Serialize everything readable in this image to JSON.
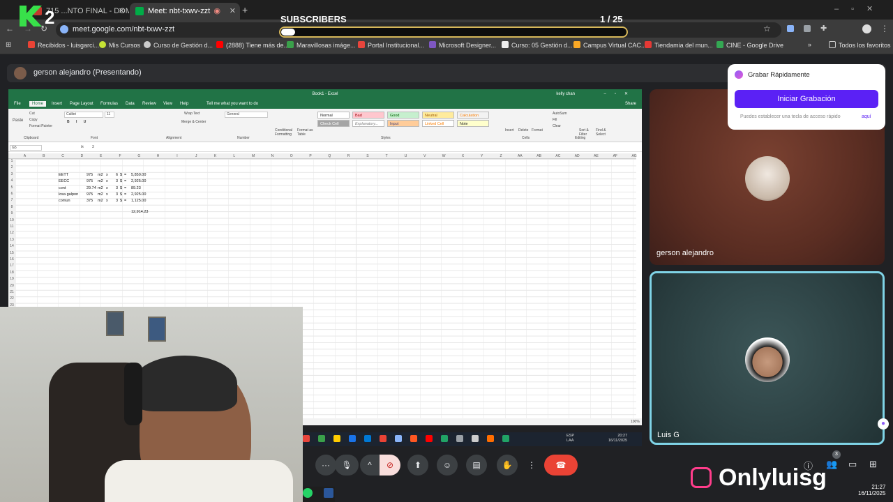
{
  "browser": {
    "tabs": [
      {
        "label": "715 ...NTO FINAL - DOMING"
      },
      {
        "label": "Meet: nbt-txwv-zzt"
      }
    ],
    "url": "meet.google.com/nbt-txwv-zzt",
    "bookmarks": [
      "Recibidos - luisgarci...",
      "Mis Cursos",
      "Curso de Gestión d...",
      "(2888) Tiene más de...",
      "Maravillosas imáge...",
      "Portal Institucional...",
      "Microsoft Designer...",
      "Curso: 05 Gestión d...",
      "Campus Virtual CAC...",
      "Tiendamia del mun...",
      "CINE - Google Drive"
    ],
    "all_bookmarks": "Todos los favoritos"
  },
  "overlay": {
    "subscribers_label": "SUBSCRIBERS",
    "subscribers_count": "1 / 25",
    "subscribers_progress": 0.04,
    "brand_name": "Onlyluisg",
    "logo_text": "K2"
  },
  "meet": {
    "presenter_label": "gerson alejandro (Presentando)",
    "participants": [
      {
        "name": "gerson alejandro"
      },
      {
        "name": "Luis G"
      }
    ],
    "people_count": "3",
    "record_popup": {
      "title": "Grabar Rápidamente",
      "button": "Iniciar Grabación",
      "hint": "Puedes establecer una tecla de acceso rápido",
      "hint_link": "aquí"
    },
    "clock_time": "21:27",
    "clock_date": "16/11/2025"
  },
  "excel": {
    "title": "Book1 - Excel",
    "user": "kelly chan",
    "share": "Share",
    "tabs": [
      "File",
      "Home",
      "Insert",
      "Page Layout",
      "Formulas",
      "Data",
      "Review",
      "View",
      "Help"
    ],
    "tell_me": "Tell me what you want to do",
    "font": "Calibri",
    "font_size": "11",
    "number_format": "General",
    "wrap_text": "Wrap Text",
    "merge_center": "Merge & Center",
    "groups": [
      "Clipboard",
      "Font",
      "Alignment",
      "Number",
      "Styles",
      "Cells",
      "Editing"
    ],
    "styles": [
      "Normal",
      "Bad",
      "Good",
      "Neutral",
      "Calculation",
      "Check Cell",
      "Explanatory...",
      "Input",
      "Linked Cell",
      "Note"
    ],
    "cells_buttons": [
      "Insert",
      "Delete",
      "Format"
    ],
    "editing_buttons": [
      "AutoSum",
      "Fill",
      "Clear",
      "Sort & Filter",
      "Find & Select"
    ],
    "conditional": "Conditional Formatting",
    "format_table": "Format as Table",
    "clipboard": [
      "Cut",
      "Copy",
      "Format Painter"
    ],
    "paste": "Paste",
    "name_box": "G5",
    "formula": "3",
    "columns": [
      "A",
      "B",
      "C",
      "D",
      "E",
      "F",
      "G",
      "H",
      "I",
      "J",
      "K",
      "L",
      "M",
      "N",
      "O",
      "P",
      "Q",
      "R",
      "S",
      "T",
      "U",
      "V",
      "W",
      "X",
      "Y",
      "Z",
      "AA",
      "AB",
      "AC",
      "AD",
      "AE",
      "AF",
      "AG"
    ],
    "rows": [
      {
        "label": "EETT",
        "qty": "975",
        "unit": "m2",
        "x": "x",
        "price": "6",
        "cur": "$",
        "eq": "=",
        "total": "5,850.00"
      },
      {
        "label": "EECC",
        "qty": "975",
        "unit": "m2",
        "x": "x",
        "price": "3",
        "cur": "$",
        "eq": "=",
        "total": "2,925.00"
      },
      {
        "label": "cont",
        "qty": "29.74",
        "unit": "m2",
        "x": "x",
        "price": "3",
        "cur": "$",
        "eq": "=",
        "total": "89.23"
      },
      {
        "label": "losa galpon",
        "qty": "975",
        "unit": "m2",
        "x": "x",
        "price": "3",
        "cur": "$",
        "eq": "=",
        "total": "2,925.00"
      },
      {
        "label": "comun",
        "qty": "375",
        "unit": "m2",
        "x": "x",
        "price": "3",
        "cur": "$",
        "eq": "=",
        "total": "1,125.00"
      }
    ],
    "grand_total": "12,914.23",
    "zoom": "100%"
  },
  "shared_taskbar": {
    "lang": "ESP",
    "lang2": "LAA",
    "time": "20:27",
    "date": "16/11/2025"
  }
}
